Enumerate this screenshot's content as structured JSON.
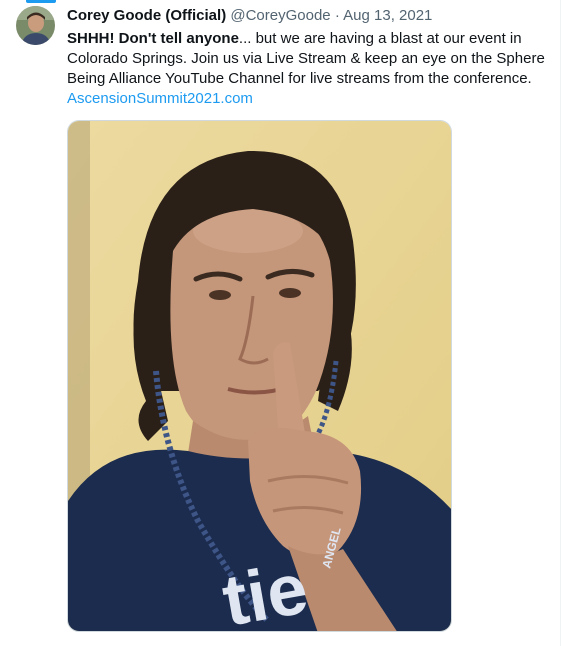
{
  "tweet": {
    "display_name": "Corey Goode (Official)",
    "handle": "@CoreyGoode",
    "separator": "·",
    "date": "Aug 13, 2021",
    "text_bold": "SHHH! Don't tell anyone",
    "text_rest": "... but we are having a blast at our event in Colorado Springs. Join us via Live Stream & keep an eye on the Sphere Being Alliance YouTube Channel for live streams from the conference.",
    "link": "AscensionSummit2021.com"
  },
  "media": {
    "shirt_print": "tie",
    "shirt_print_small": "ANGEL"
  },
  "colors": {
    "accent": "#1d9bf0",
    "text_primary": "#0f1419",
    "text_secondary": "#536471",
    "wall": "#e9d79b",
    "shirt": "#1c2c4e"
  },
  "icons": {
    "avatar": "user-avatar"
  }
}
